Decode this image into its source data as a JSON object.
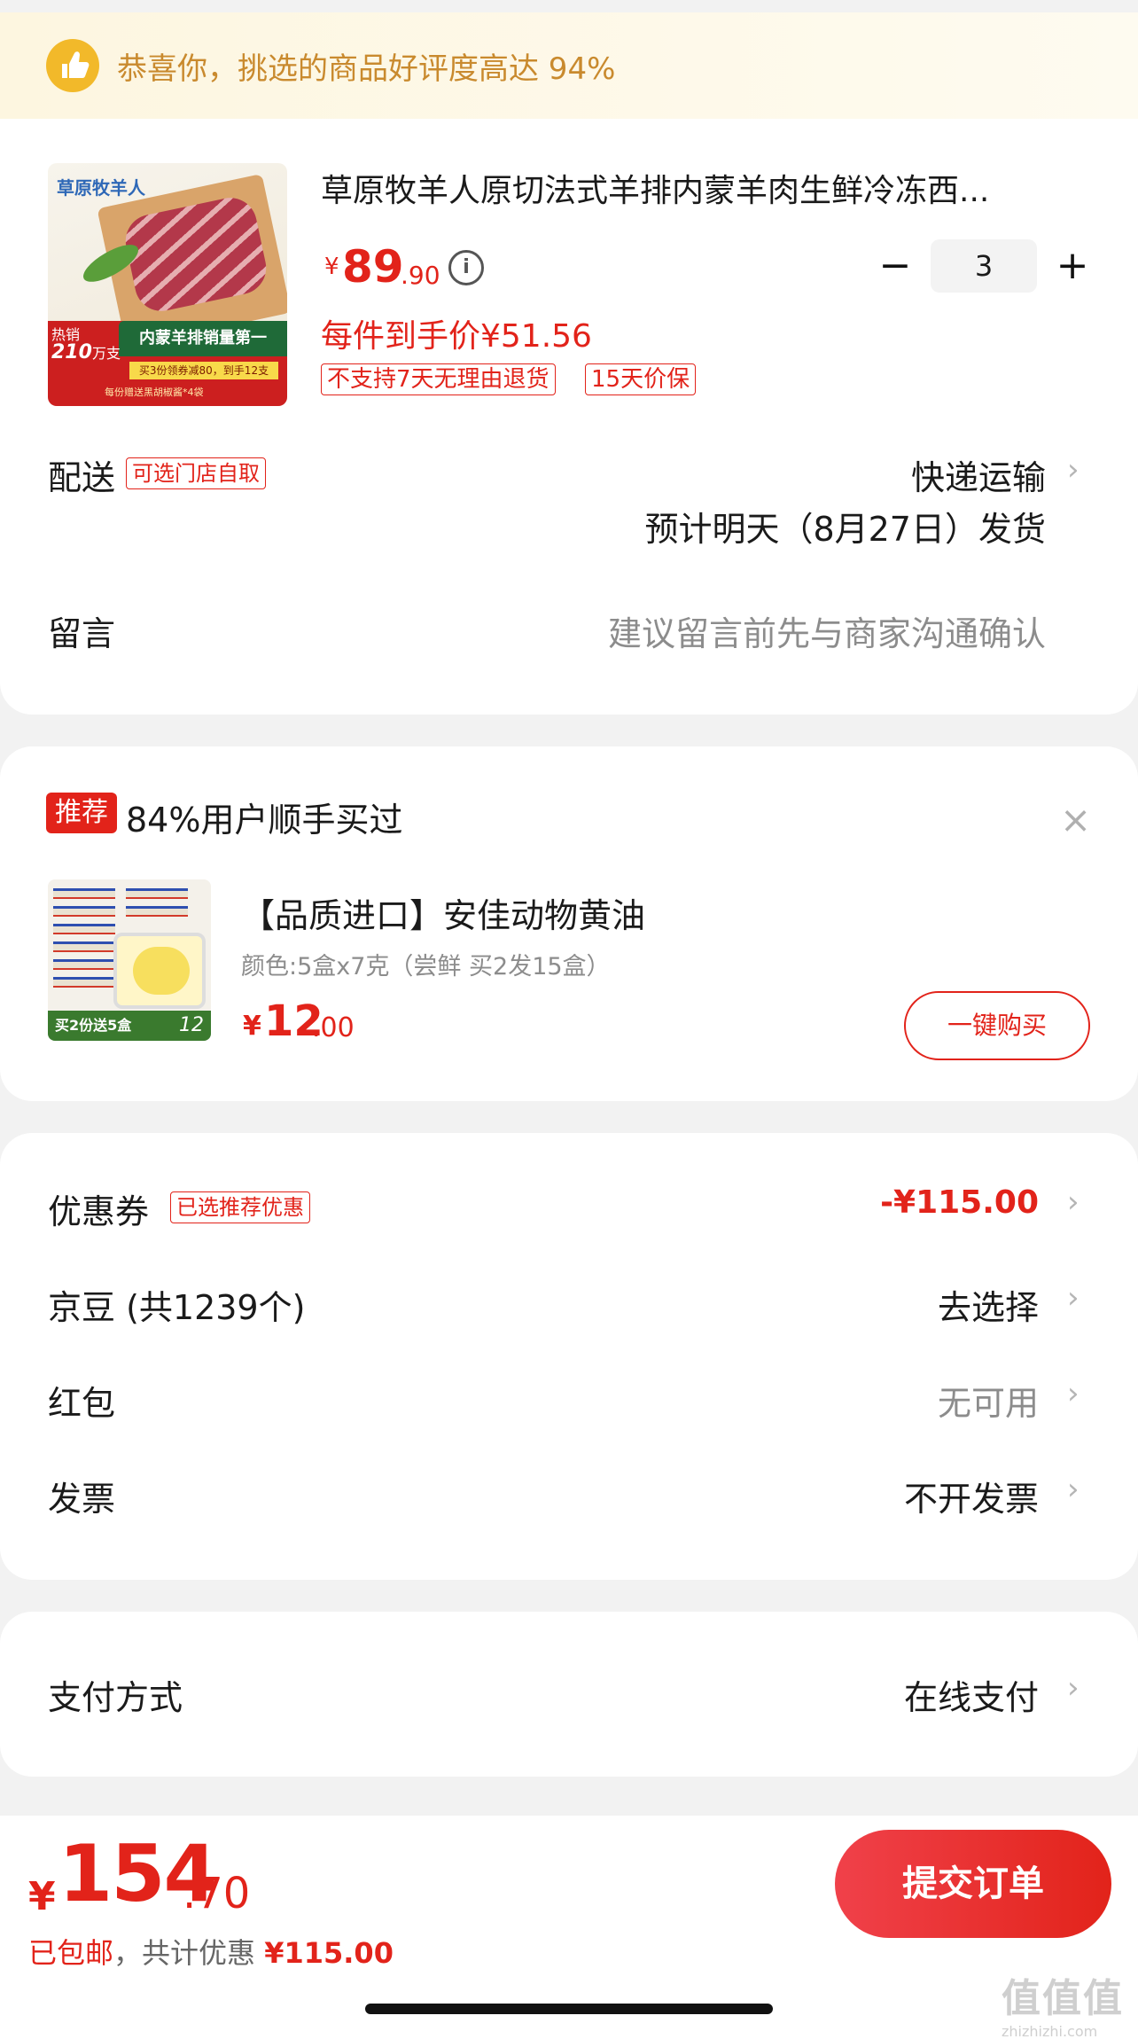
{
  "banner": {
    "text": "恭喜你，挑选的商品好评度高达 94%"
  },
  "product": {
    "title": "草原牧羊人原切法式羊排内蒙羊肉生鲜冷冻西...",
    "image": {
      "brand": "草原牧羊人",
      "hot_label": "热销",
      "hot_count": "210",
      "hot_unit": "万支",
      "slogan": "内蒙羊排销量第一",
      "promo": "买3份领券减80，到手12支",
      "gift": "每份赠送黑胡椒酱*4袋"
    },
    "price_symbol": "¥",
    "price_int": "89",
    "price_dec": ".90",
    "quantity": "3",
    "each_price": "每件到手价¥51.56",
    "tags": [
      "不支持7天无理由退货",
      "15天价保"
    ]
  },
  "delivery": {
    "label": "配送",
    "tag": "可选门店自取",
    "method": "快递运输",
    "eta": "预计明天（8月27日）发货"
  },
  "message": {
    "label": "留言",
    "placeholder": "建议留言前先与商家沟通确认"
  },
  "recommend": {
    "badge": "推荐",
    "title": "84%用户顺手买过",
    "name": "【品质进口】安佳动物黄油",
    "spec": "颜色:5盒x7克（尝鲜  买2发15盒）",
    "image_promo": "买2份送5盒",
    "image_price": "12",
    "price_symbol": "¥",
    "price_int": "12",
    "price_dec": ".00",
    "buy_label": "一键购买"
  },
  "discounts": {
    "coupon_label": "优惠券",
    "coupon_tag": "已选推荐优惠",
    "coupon_value": "-¥115.00",
    "jingdou_label": "京豆 (共1239个)",
    "jingdou_value": "去选择",
    "redpacket_label": "红包",
    "redpacket_value": "无可用",
    "invoice_label": "发票",
    "invoice_value": "不开发票"
  },
  "payment": {
    "label": "支付方式",
    "value": "在线支付"
  },
  "bottom": {
    "total_symbol": "¥",
    "total_int": "154",
    "total_dec": ".70",
    "shipping": "已包邮",
    "saved_prefix": "，共计优惠 ",
    "saved_amount": "¥115.00",
    "submit_label": "提交订单"
  },
  "watermark": {
    "top": "值值值",
    "bottom": "zhizhizhi.com"
  },
  "colors": {
    "accent": "#e2231a",
    "banner_text": "#c98a2e",
    "muted": "#8c8c8c"
  },
  "icons": [
    "thumbs-up-icon",
    "info-icon",
    "minus-icon",
    "plus-icon",
    "chevron-right-icon",
    "close-icon"
  ]
}
